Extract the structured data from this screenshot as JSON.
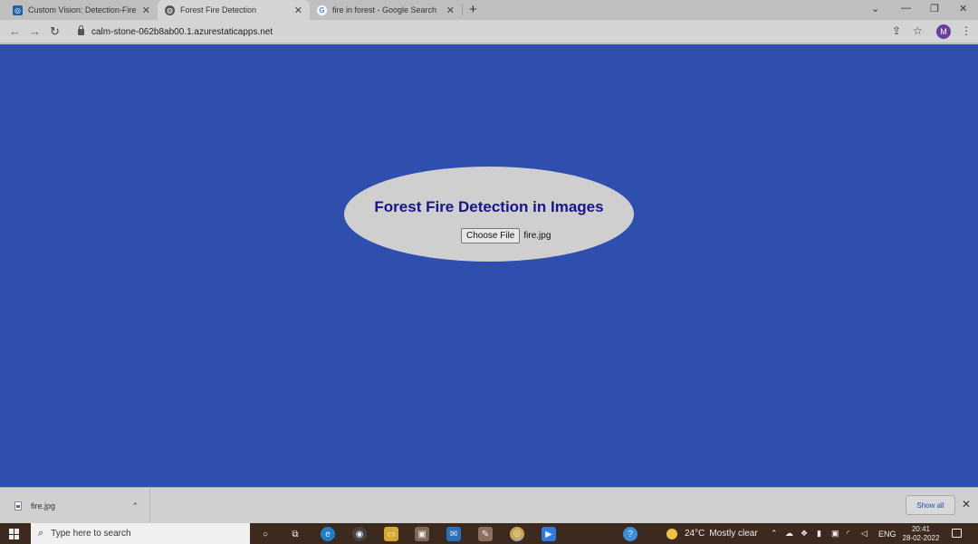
{
  "browser": {
    "tabs": [
      {
        "title": "Custom Vision: Detection-Fire - I",
        "icon": "custom-vision-icon"
      },
      {
        "title": "Forest Fire Detection",
        "icon": "globe-icon",
        "active": true
      },
      {
        "title": "fire in forest - Google Search",
        "icon": "google-icon"
      }
    ],
    "new_tab_symbol": "+",
    "close_symbol": "✕",
    "address_bar": {
      "url": "calm-stone-062b8ab00.1.azurestaticapps.net"
    },
    "profile_initial": "M"
  },
  "page": {
    "title": "Forest Fire Detection in Images",
    "file_input": {
      "button_label": "Choose File",
      "file_name": "fire.jpg"
    },
    "colors": {
      "background": "#2f4fae",
      "panel": "#cfcfcf",
      "title": "#16168a"
    }
  },
  "downloads_bar": {
    "item": {
      "file_name": "fire.jpg"
    },
    "show_all_label": "Show all"
  },
  "taskbar": {
    "search_placeholder": "Type here to search",
    "weather": {
      "temperature": "24°C",
      "condition": "Mostly clear"
    },
    "language": "ENG",
    "time": "20:41",
    "date": "28-02-2022"
  }
}
